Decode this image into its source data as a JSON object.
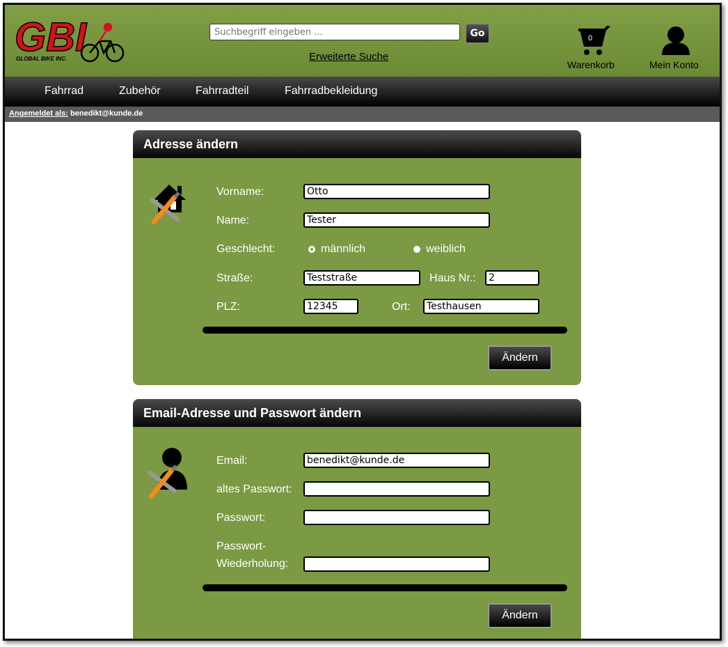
{
  "header": {
    "logo_text": "GBI",
    "logo_tagline": "GLOBAL BIKE INC.",
    "search_placeholder": "Suchbegriff eingeben ...",
    "go_label": "Go",
    "advanced_search": "Erweiterte Suche",
    "cart_count": "0",
    "cart_label": "Warenkorb",
    "account_label": "Mein Konto"
  },
  "nav": {
    "items": [
      "Fahrrad",
      "Zubehör",
      "Fahrradteil",
      "Fahrradbekleidung"
    ]
  },
  "login": {
    "label": "Angemeldet als:",
    "user": "benedikt@kunde.de"
  },
  "address_panel": {
    "title": "Adresse ändern",
    "vorname_label": "Vorname:",
    "vorname_value": "Otto",
    "name_label": "Name:",
    "name_value": "Tester",
    "gender_label": "Geschlecht:",
    "gender_male": "männlich",
    "gender_female": "weiblich",
    "gender_selected": "männlich",
    "street_label": "Straße:",
    "street_value": "Teststraße",
    "house_label": "Haus Nr.:",
    "house_value": "2",
    "plz_label": "PLZ:",
    "plz_value": "12345",
    "city_label": "Ort:",
    "city_value": "Testhausen",
    "submit_label": "Ändern"
  },
  "account_panel": {
    "title": "Email-Adresse und Passwort ändern",
    "email_label": "Email:",
    "email_value": "benedikt@kunde.de",
    "old_pw_label": "altes Passwort:",
    "pw_label": "Passwort:",
    "pw_repeat_label_1": "Passwort-",
    "pw_repeat_label_2": "Wiederholung:",
    "submit_label": "Ändern"
  },
  "colors": {
    "panel_green": "#7b9a43",
    "header_green": "#7a9a42",
    "logo_red": "#d4121b",
    "tool_orange": "#f28c1b"
  }
}
